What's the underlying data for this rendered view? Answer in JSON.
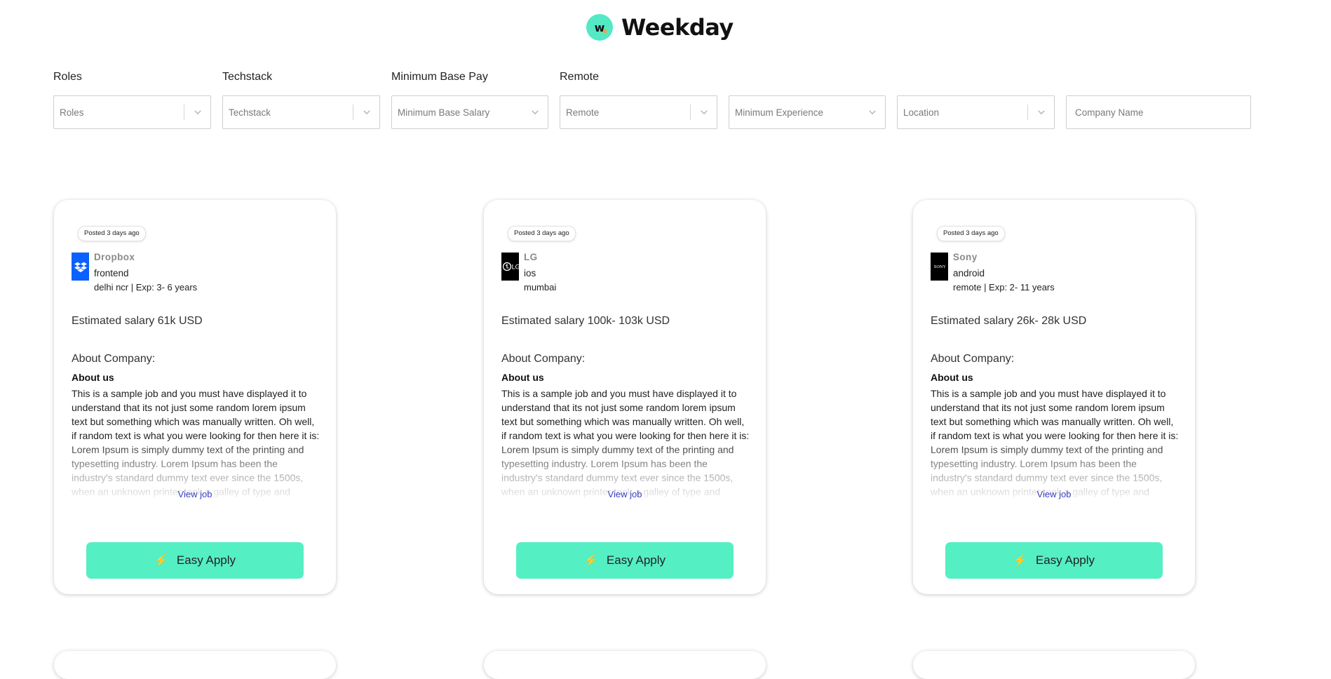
{
  "brand": {
    "name": "Weekday",
    "logo_letter": "w"
  },
  "filters": {
    "labels": [
      "Roles",
      "Techstack",
      "Minimum Base Pay",
      "Remote"
    ],
    "dropdowns": [
      {
        "placeholder": "Roles"
      },
      {
        "placeholder": "Techstack"
      },
      {
        "placeholder": "Minimum Base Salary"
      },
      {
        "placeholder": "Remote"
      },
      {
        "placeholder": "Minimum Experience"
      },
      {
        "placeholder": "Location"
      }
    ],
    "company_name_placeholder": "Company Name"
  },
  "jobs": [
    {
      "posted": "Posted 3 days ago",
      "company": "Dropbox",
      "role": "frontend",
      "location_exp": "delhi ncr | Exp: 3- 6 years",
      "salary": "Estimated salary 61k USD",
      "about_heading": "About Company:",
      "about_sub": "About us",
      "description": "This is a sample job and you must have displayed it to understand that its not just some random lorem ipsum text but something which was manually written. Oh well, if random text is what you were looking for then here it is: Lorem Ipsum is simply dummy text of the printing and typesetting industry. Lorem Ipsum has been the industry's standard dummy text ever since the 1500s, when an unknown printer took a galley of type and scrambled it to make a type specimen book.",
      "view_job": "View job",
      "apply_label": "Easy Apply"
    },
    {
      "posted": "Posted 3 days ago",
      "company": "LG",
      "role": "ios",
      "location_exp": "mumbai",
      "salary": "Estimated salary 100k- 103k USD",
      "about_heading": "About Company:",
      "about_sub": "About us",
      "description": "This is a sample job and you must have displayed it to understand that its not just some random lorem ipsum text but something which was manually written. Oh well, if random text is what you were looking for then here it is: Lorem Ipsum is simply dummy text of the printing and typesetting industry. Lorem Ipsum has been the industry's standard dummy text ever since the 1500s, when an unknown printer took a galley of type and scrambled it to make a type specimen book.",
      "view_job": "View job",
      "apply_label": "Easy Apply"
    },
    {
      "posted": "Posted 3 days ago",
      "company": "Sony",
      "role": "android",
      "location_exp": "remote | Exp: 2- 11 years",
      "salary": "Estimated salary 26k- 28k USD",
      "about_heading": "About Company:",
      "about_sub": "About us",
      "description": "This is a sample job and you must have displayed it to understand that its not just some random lorem ipsum text but something which was manually written. Oh well, if random text is what you were looking for then here it is: Lorem Ipsum is simply dummy text of the printing and typesetting industry. Lorem Ipsum has been the industry's standard dummy text ever since the 1500s, when an unknown printer took a galley of type and scrambled it to make a type specimen book.",
      "view_job": "View job",
      "apply_label": "Easy Apply"
    }
  ],
  "icons": {
    "chevron": "chevron-down-icon",
    "bolt": "lightning-bolt-icon",
    "bolt_color": "#ff6a1a"
  },
  "colors": {
    "accent": "#55efc4",
    "link": "#3b3fc4",
    "dropbox_blue": "#0a61fe"
  }
}
